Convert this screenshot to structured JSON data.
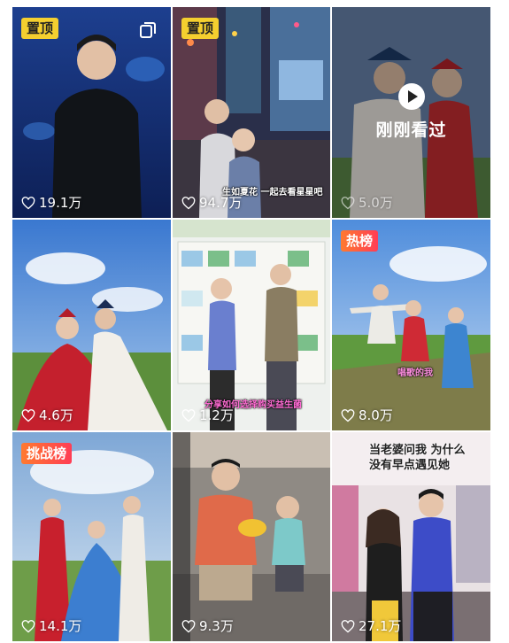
{
  "videos": [
    {
      "badge": "置顶",
      "likes": "19.1万",
      "multi": true
    },
    {
      "badge": "置顶",
      "likes": "94.7万",
      "caption": "生如夏花 一起去看星星吧"
    },
    {
      "overlay": "刚刚看过",
      "likes": "5.0万"
    },
    {
      "likes": "4.6万"
    },
    {
      "likes": "1.2万",
      "caption": "分享如何选择购买益生菌"
    },
    {
      "badge": "热榜",
      "likes": "8.0万",
      "caption": "唱歌的我"
    },
    {
      "badge": "挑战榜",
      "likes": "14.1万"
    },
    {
      "likes": "9.3万"
    },
    {
      "likes": "27.1万",
      "caption": "当老婆问我 为什么没有早点遇见她"
    }
  ]
}
